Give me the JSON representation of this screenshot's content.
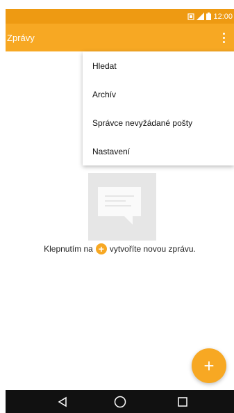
{
  "status_bar": {
    "time": "12:00"
  },
  "app_bar": {
    "title": "Zprávy",
    "menu_icon": "overflow-dots-icon"
  },
  "menu": {
    "items": [
      {
        "label": "Hledat"
      },
      {
        "label": "Archív"
      },
      {
        "label": "Správce nevyžádané pošty"
      },
      {
        "label": "Nastavení"
      }
    ]
  },
  "empty_state": {
    "icon": "message-bubble-icon",
    "text_before": "Klepnutím na",
    "text_after": "vytvoříte novou zprávu."
  },
  "fab": {
    "icon": "plus-icon",
    "label": "+"
  },
  "nav": {
    "back_icon": "back-icon",
    "home_icon": "home-icon",
    "recents_icon": "recents-icon"
  },
  "colors": {
    "status_bar": "#ee9a12",
    "app_bar": "#f7a823",
    "accent": "#f7a823",
    "nav_bar": "#111111"
  }
}
